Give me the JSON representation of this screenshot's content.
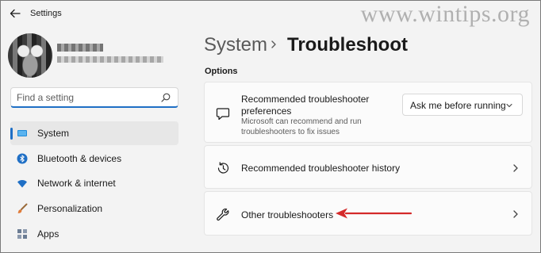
{
  "window": {
    "title": "Settings",
    "back_icon": "back-arrow-icon"
  },
  "watermark": "www.wintips.org",
  "search": {
    "placeholder": "Find a setting",
    "icon": "search-icon"
  },
  "sidebar": {
    "items": [
      {
        "label": "System",
        "icon": "system-icon",
        "selected": true
      },
      {
        "label": "Bluetooth & devices",
        "icon": "bluetooth-icon",
        "selected": false
      },
      {
        "label": "Network & internet",
        "icon": "network-icon",
        "selected": false
      },
      {
        "label": "Personalization",
        "icon": "personalization-icon",
        "selected": false
      },
      {
        "label": "Apps",
        "icon": "apps-icon",
        "selected": false
      }
    ]
  },
  "breadcrumb": {
    "parent": "System",
    "separator_icon": "chevron-right-icon",
    "current": "Troubleshoot"
  },
  "main": {
    "section_title": "Options",
    "cards": [
      {
        "title": "Recommended troubleshooter preferences",
        "description": "Microsoft can recommend and run troubleshooters to fix issues",
        "icon": "message-icon",
        "dropdown_value": "Ask me before running"
      },
      {
        "title": "Recommended troubleshooter history",
        "icon": "history-icon"
      },
      {
        "title": "Other troubleshooters",
        "icon": "wrench-icon"
      }
    ]
  },
  "colors": {
    "accent": "#1f6fc5",
    "annotation_arrow": "#d42a2a",
    "background": "#f3f3f3",
    "card": "#fbfbfb"
  }
}
